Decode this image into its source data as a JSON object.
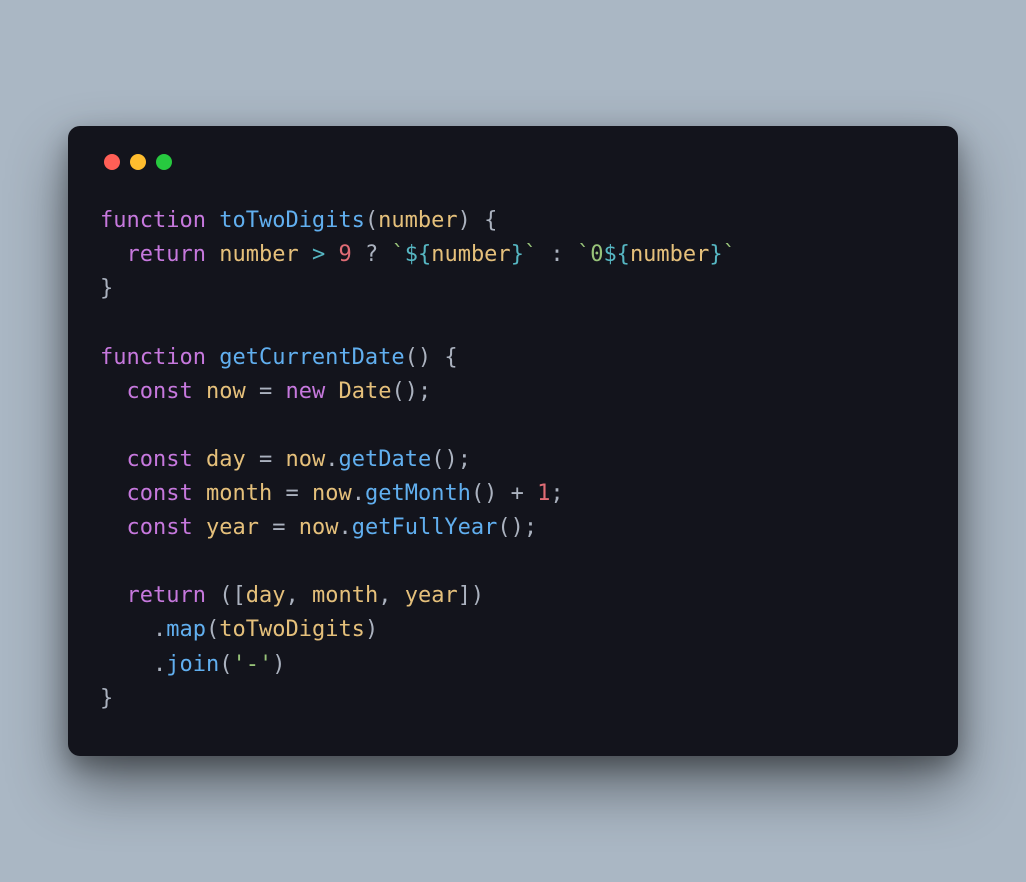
{
  "colors": {
    "bg_page": "#aab7c4",
    "bg_window": "#13141c",
    "traffic_red": "#ff5f56",
    "traffic_yellow": "#ffbd2e",
    "traffic_green": "#27c93f",
    "tok_keyword": "#c678dd",
    "tok_function": "#61afef",
    "tok_ident": "#e5c07b",
    "tok_number": "#d19a66",
    "tok_string": "#98c379",
    "tok_template": "#56b6c2",
    "tok_default": "#abb2bf"
  },
  "code": {
    "lines": [
      [
        {
          "t": "function ",
          "c": "tok-kw"
        },
        {
          "t": "toTwoDigits",
          "c": "tok-fn"
        },
        {
          "t": "(",
          "c": "tok-punc"
        },
        {
          "t": "number",
          "c": "tok-id"
        },
        {
          "t": ") {",
          "c": "tok-punc"
        }
      ],
      [
        {
          "t": "  ",
          "c": "tok-punc"
        },
        {
          "t": "return ",
          "c": "tok-kw"
        },
        {
          "t": "number",
          "c": "tok-id"
        },
        {
          "t": " > ",
          "c": "tok-op"
        },
        {
          "t": "9",
          "c": "tok-num-red"
        },
        {
          "t": " ? ",
          "c": "tok-punc"
        },
        {
          "t": "`",
          "c": "tok-str"
        },
        {
          "t": "${",
          "c": "tok-tpl"
        },
        {
          "t": "number",
          "c": "tok-id"
        },
        {
          "t": "}",
          "c": "tok-tpl"
        },
        {
          "t": "`",
          "c": "tok-str"
        },
        {
          "t": " : ",
          "c": "tok-punc"
        },
        {
          "t": "`",
          "c": "tok-str"
        },
        {
          "t": "0",
          "c": "tok-str"
        },
        {
          "t": "${",
          "c": "tok-tpl"
        },
        {
          "t": "number",
          "c": "tok-id"
        },
        {
          "t": "}",
          "c": "tok-tpl"
        },
        {
          "t": "`",
          "c": "tok-str"
        }
      ],
      [
        {
          "t": "}",
          "c": "tok-punc"
        }
      ],
      [
        {
          "t": "",
          "c": "tok-punc"
        }
      ],
      [
        {
          "t": "function ",
          "c": "tok-kw"
        },
        {
          "t": "getCurrentDate",
          "c": "tok-fn"
        },
        {
          "t": "() {",
          "c": "tok-punc"
        }
      ],
      [
        {
          "t": "  ",
          "c": "tok-punc"
        },
        {
          "t": "const ",
          "c": "tok-kw"
        },
        {
          "t": "now",
          "c": "tok-id"
        },
        {
          "t": " = ",
          "c": "tok-punc"
        },
        {
          "t": "new ",
          "c": "tok-kw"
        },
        {
          "t": "Date",
          "c": "tok-class"
        },
        {
          "t": "();",
          "c": "tok-punc"
        }
      ],
      [
        {
          "t": "",
          "c": "tok-punc"
        }
      ],
      [
        {
          "t": "  ",
          "c": "tok-punc"
        },
        {
          "t": "const ",
          "c": "tok-kw"
        },
        {
          "t": "day",
          "c": "tok-id"
        },
        {
          "t": " = ",
          "c": "tok-punc"
        },
        {
          "t": "now",
          "c": "tok-id"
        },
        {
          "t": ".",
          "c": "tok-punc"
        },
        {
          "t": "getDate",
          "c": "tok-fn"
        },
        {
          "t": "();",
          "c": "tok-punc"
        }
      ],
      [
        {
          "t": "  ",
          "c": "tok-punc"
        },
        {
          "t": "const ",
          "c": "tok-kw"
        },
        {
          "t": "month",
          "c": "tok-id"
        },
        {
          "t": " = ",
          "c": "tok-punc"
        },
        {
          "t": "now",
          "c": "tok-id"
        },
        {
          "t": ".",
          "c": "tok-punc"
        },
        {
          "t": "getMonth",
          "c": "tok-fn"
        },
        {
          "t": "() + ",
          "c": "tok-punc"
        },
        {
          "t": "1",
          "c": "tok-num-red"
        },
        {
          "t": ";",
          "c": "tok-punc"
        }
      ],
      [
        {
          "t": "  ",
          "c": "tok-punc"
        },
        {
          "t": "const ",
          "c": "tok-kw"
        },
        {
          "t": "year",
          "c": "tok-id"
        },
        {
          "t": " = ",
          "c": "tok-punc"
        },
        {
          "t": "now",
          "c": "tok-id"
        },
        {
          "t": ".",
          "c": "tok-punc"
        },
        {
          "t": "getFullYear",
          "c": "tok-fn"
        },
        {
          "t": "();",
          "c": "tok-punc"
        }
      ],
      [
        {
          "t": "",
          "c": "tok-punc"
        }
      ],
      [
        {
          "t": "  ",
          "c": "tok-punc"
        },
        {
          "t": "return ",
          "c": "tok-kw"
        },
        {
          "t": "([",
          "c": "tok-punc"
        },
        {
          "t": "day",
          "c": "tok-id"
        },
        {
          "t": ", ",
          "c": "tok-punc"
        },
        {
          "t": "month",
          "c": "tok-id"
        },
        {
          "t": ", ",
          "c": "tok-punc"
        },
        {
          "t": "year",
          "c": "tok-id"
        },
        {
          "t": "])",
          "c": "tok-punc"
        }
      ],
      [
        {
          "t": "    .",
          "c": "tok-punc"
        },
        {
          "t": "map",
          "c": "tok-fn"
        },
        {
          "t": "(",
          "c": "tok-punc"
        },
        {
          "t": "toTwoDigits",
          "c": "tok-id"
        },
        {
          "t": ")",
          "c": "tok-punc"
        }
      ],
      [
        {
          "t": "    .",
          "c": "tok-punc"
        },
        {
          "t": "join",
          "c": "tok-fn"
        },
        {
          "t": "(",
          "c": "tok-punc"
        },
        {
          "t": "'-'",
          "c": "tok-str"
        },
        {
          "t": ")",
          "c": "tok-punc"
        }
      ],
      [
        {
          "t": "}",
          "c": "tok-punc"
        }
      ]
    ]
  }
}
